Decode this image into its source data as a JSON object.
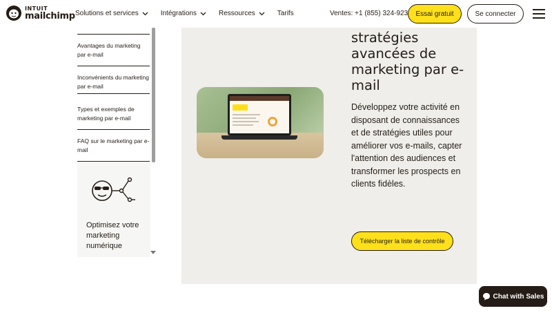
{
  "header": {
    "logo_top": "INTUIT",
    "logo_bottom": "mailchimp",
    "nav": [
      {
        "label": "Solutions et services",
        "has_chevron": true
      },
      {
        "label": "Intégrations",
        "has_chevron": true
      },
      {
        "label": "Ressources",
        "has_chevron": true
      },
      {
        "label": "Tarifs",
        "has_chevron": false
      }
    ],
    "phone": "Ventes: +1 (855) 324-9230",
    "trial_button": "Essai gratuit",
    "login_button": "Se connecter"
  },
  "sidebar": {
    "items": [
      {
        "label": "Avantages du marketing par e-mail"
      },
      {
        "label": "Inconvénients du marketing par e-mail"
      },
      {
        "label": "Types et exemples de marketing par e-mail"
      },
      {
        "label": "FAQ sur le marketing par e-mail"
      }
    ],
    "promo_text": "Optimisez votre marketing numérique"
  },
  "main": {
    "heading": "stratégies avancées de marketing par e-mail",
    "body": "Développez votre activité en disposant de connaissances et de stratégies utiles pour améliorer vos e-mails, capter l'attention des audiences et transformer les prospects en clients fidèles.",
    "download_button": "Télécharger la liste de contrôle"
  },
  "chat": {
    "label": "Chat with Sales"
  },
  "colors": {
    "accent_yellow": "#ffe01b",
    "text_dark": "#241c15",
    "panel_bg": "#efeeea"
  }
}
